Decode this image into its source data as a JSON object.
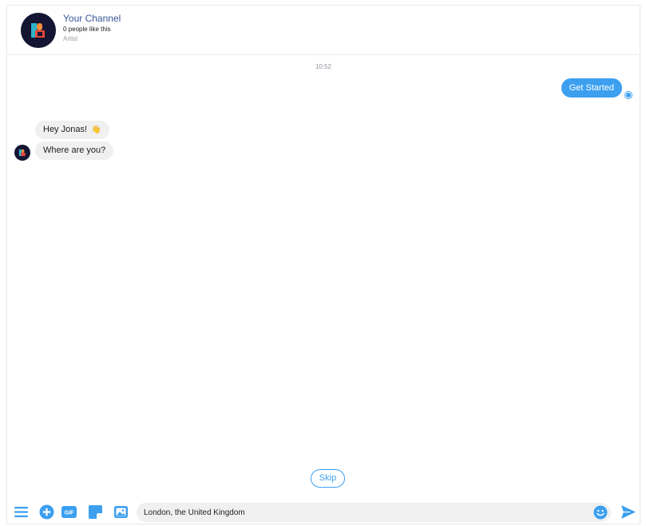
{
  "header": {
    "title": "Your Channel",
    "likes": "0 people like this",
    "category": "Artist"
  },
  "thread": {
    "timestamp": "10:52",
    "outgoing": [
      {
        "text": "Get Started"
      }
    ],
    "incoming": [
      {
        "text": "Hey Jonas!",
        "emoji": "👋"
      },
      {
        "text": "Where are you?"
      }
    ]
  },
  "quick_reply": {
    "skip_label": "Skip"
  },
  "composer": {
    "value": "London, the United Kingdom",
    "tools": [
      "menu-icon",
      "plus-icon",
      "gif-icon",
      "sticker-icon",
      "image-icon"
    ],
    "emoji_icon": "smiley-icon",
    "send_icon": "send-icon"
  },
  "colors": {
    "accent": "#3c9ff0",
    "link": "#385898",
    "bubble_in": "#f1f0f0",
    "avatar_bg": "#141433"
  }
}
